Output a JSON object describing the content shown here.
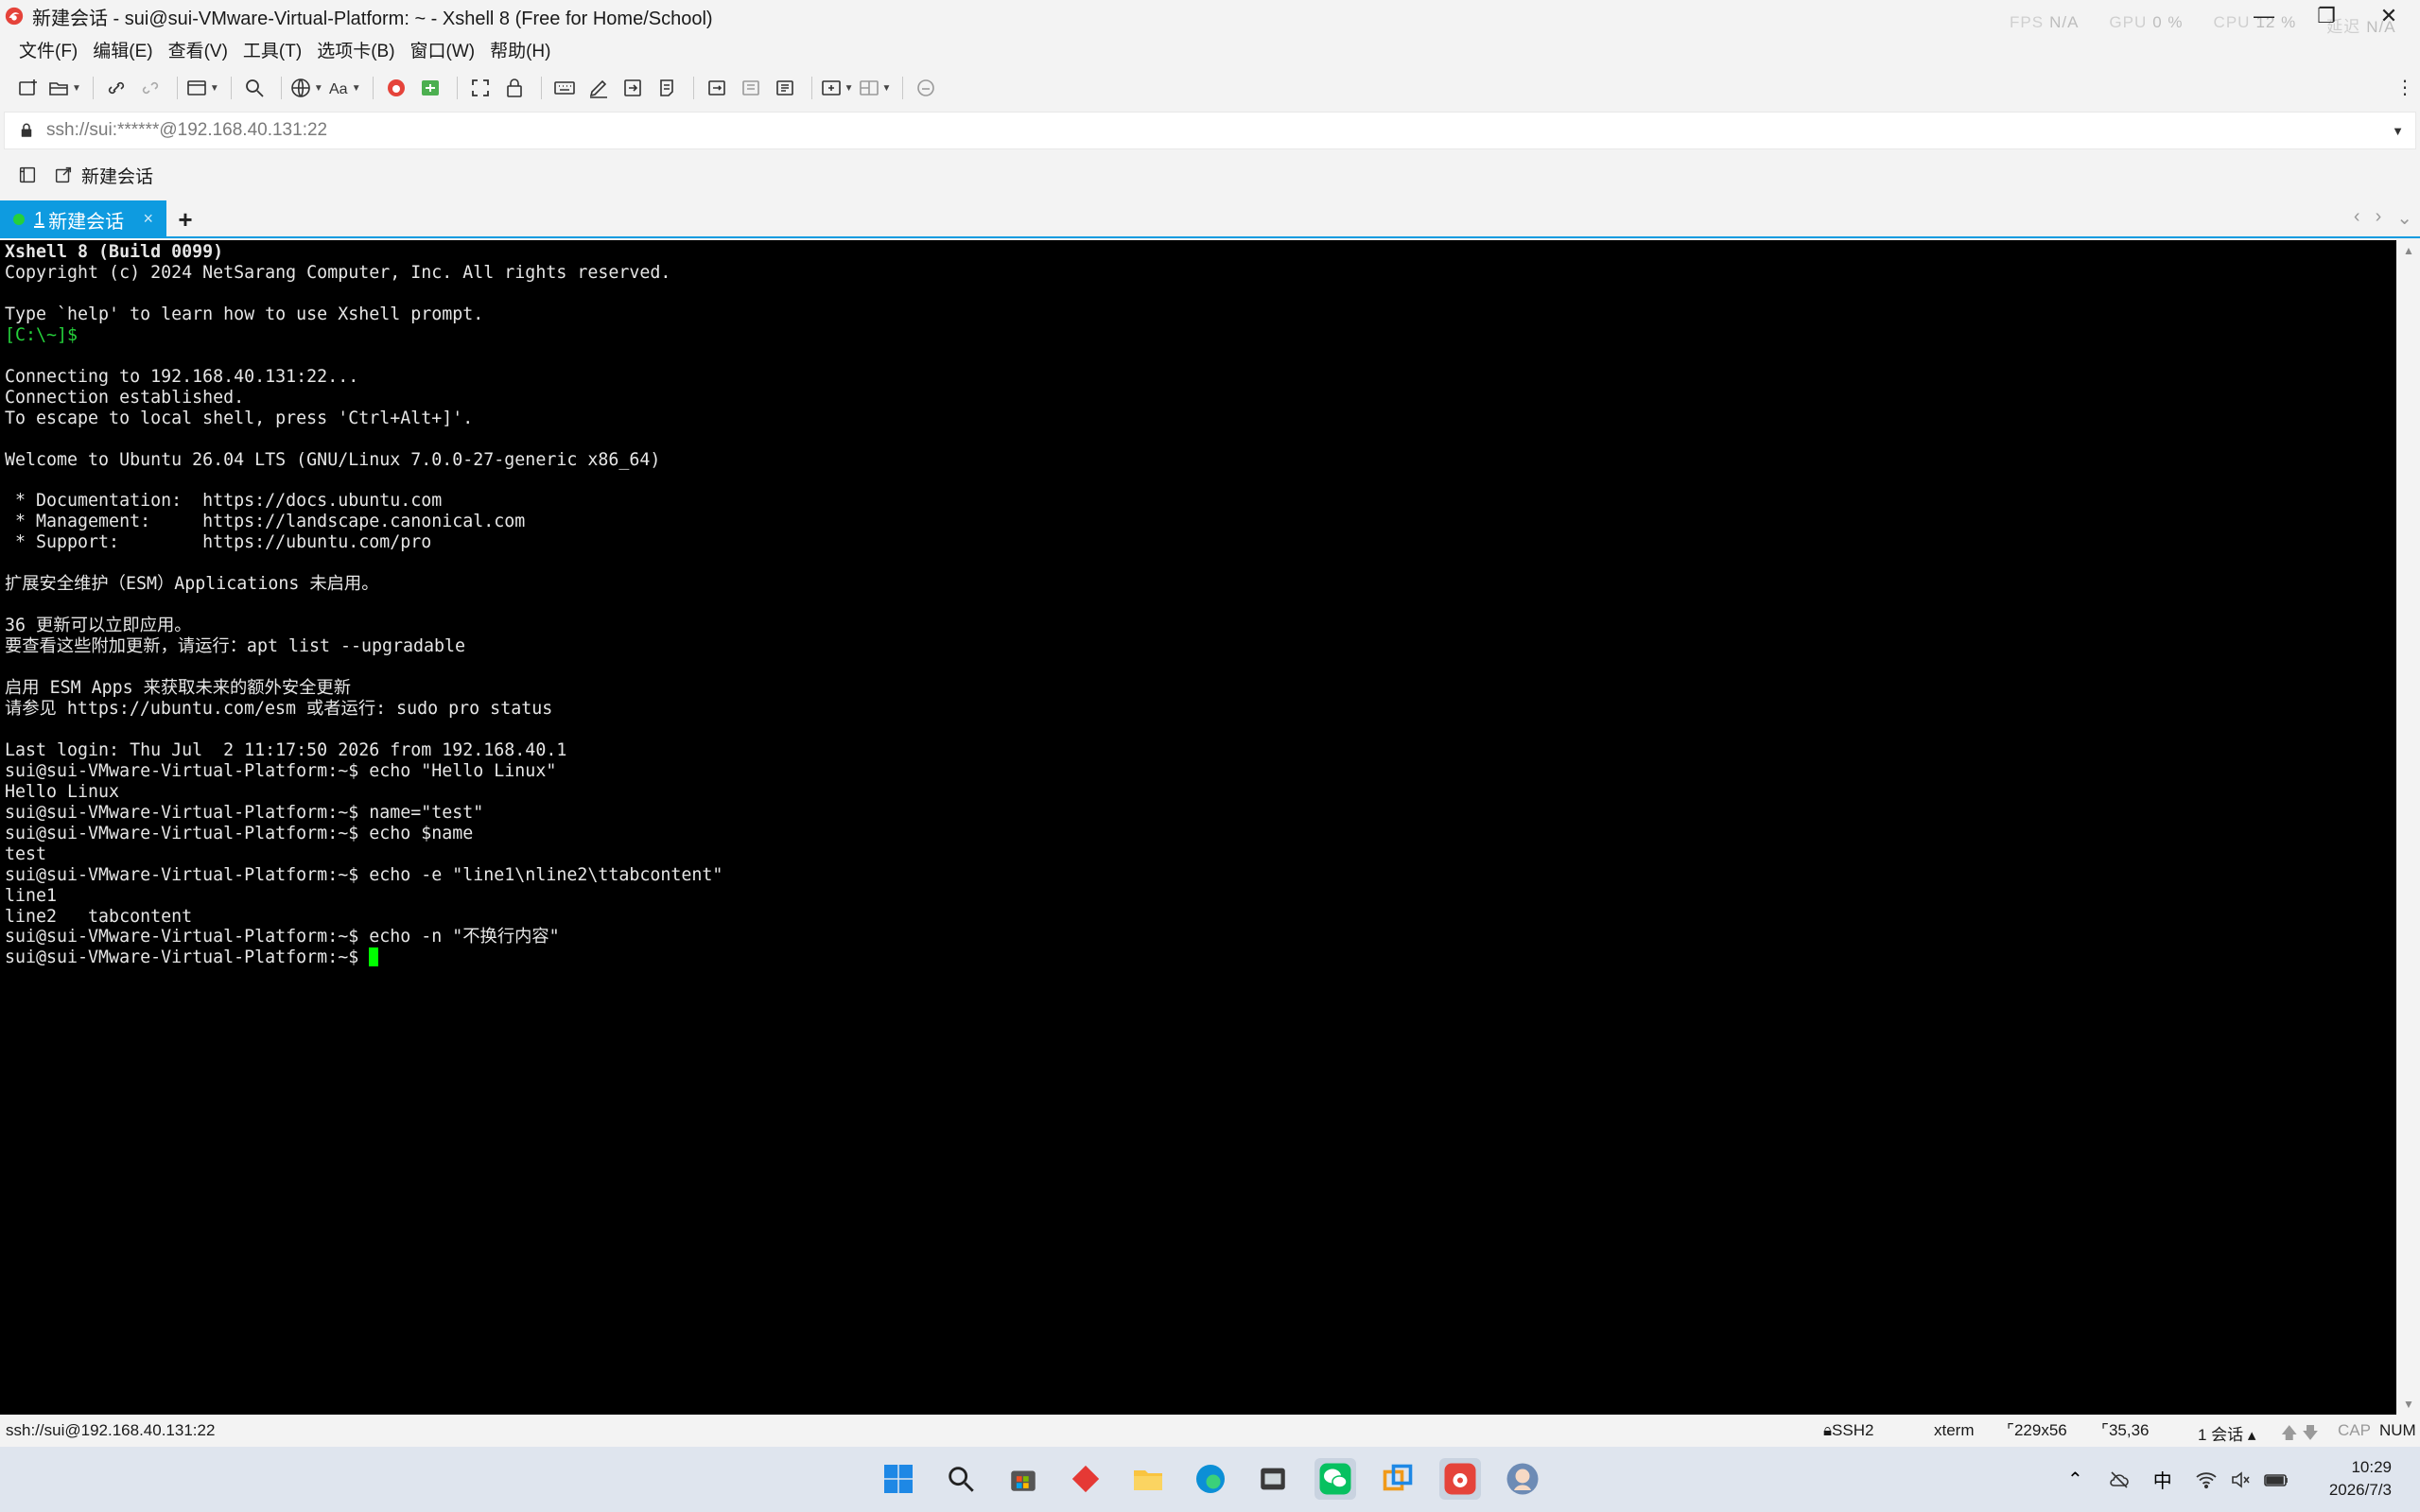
{
  "window": {
    "title": "新建会话 - sui@sui-VMware-Virtual-Platform: ~ - Xshell 8 (Free for Home/School)",
    "perf": [
      {
        "label": "FPS",
        "value": "N/A"
      },
      {
        "label": "GPU",
        "value": "0 %"
      },
      {
        "label": "CPU",
        "value": "12 %"
      },
      {
        "label": "延迟",
        "value": "N/A"
      }
    ],
    "controls": {
      "minimize": "—",
      "maximize": "❐",
      "close": "✕"
    }
  },
  "menu": [
    "文件(F)",
    "编辑(E)",
    "查看(V)",
    "工具(T)",
    "选项卡(B)",
    "窗口(W)",
    "帮助(H)"
  ],
  "address": {
    "value": "ssh://sui:******@192.168.40.131:22"
  },
  "quick": {
    "new_session": "新建会话"
  },
  "tabs": [
    {
      "number": "1",
      "label": "新建会话",
      "close": "×",
      "active": true
    }
  ],
  "tab_add": "+",
  "terminal": {
    "lines": [
      [
        {
          "t": "Xshell 8 (Build 0099)",
          "c": "bold"
        }
      ],
      [
        {
          "t": "Copyright (c) 2024 NetSarang Computer, Inc. All rights reserved."
        }
      ],
      [
        {
          "t": ""
        }
      ],
      [
        {
          "t": "Type `help' to learn how to use Xshell prompt."
        }
      ],
      [
        {
          "t": "[C:\\~]$",
          "c": "green"
        }
      ],
      [
        {
          "t": ""
        }
      ],
      [
        {
          "t": "Connecting to 192.168.40.131:22..."
        }
      ],
      [
        {
          "t": "Connection established."
        }
      ],
      [
        {
          "t": "To escape to local shell, press 'Ctrl+Alt+]'."
        }
      ],
      [
        {
          "t": ""
        }
      ],
      [
        {
          "t": "Welcome to Ubuntu 26.04 LTS (GNU/Linux 7.0.0-27-generic x86_64)"
        }
      ],
      [
        {
          "t": ""
        }
      ],
      [
        {
          "t": " * Documentation:  https://docs.ubuntu.com"
        }
      ],
      [
        {
          "t": " * Management:     https://landscape.canonical.com"
        }
      ],
      [
        {
          "t": " * Support:        https://ubuntu.com/pro"
        }
      ],
      [
        {
          "t": ""
        }
      ],
      [
        {
          "t": "扩展安全维护（ESM）Applications 未启用。"
        }
      ],
      [
        {
          "t": ""
        }
      ],
      [
        {
          "t": "36 更新可以立即应用。"
        }
      ],
      [
        {
          "t": "要查看这些附加更新，请运行：apt list --upgradable"
        }
      ],
      [
        {
          "t": ""
        }
      ],
      [
        {
          "t": "启用 ESM Apps 来获取未来的额外安全更新"
        }
      ],
      [
        {
          "t": "请参见 https://ubuntu.com/esm 或者运行: sudo pro status"
        }
      ],
      [
        {
          "t": ""
        }
      ],
      [
        {
          "t": "Last login: Thu Jul  2 11:17:50 2026 from 192.168.40.1"
        }
      ],
      [
        {
          "t": "sui@sui-VMware-Virtual-Platform:~$ echo \"Hello Linux\""
        }
      ],
      [
        {
          "t": "Hello Linux"
        }
      ],
      [
        {
          "t": "sui@sui-VMware-Virtual-Platform:~$ name=\"test\""
        }
      ],
      [
        {
          "t": "sui@sui-VMware-Virtual-Platform:~$ echo $name"
        }
      ],
      [
        {
          "t": "test"
        }
      ],
      [
        {
          "t": "sui@sui-VMware-Virtual-Platform:~$ echo -e \"line1\\nline2\\ttabcontent\""
        }
      ],
      [
        {
          "t": "line1"
        }
      ],
      [
        {
          "t": "line2   tabcontent"
        }
      ],
      [
        {
          "t": "sui@sui-VMware-Virtual-Platform:~$ echo -n \"不换行内容\""
        }
      ],
      [
        {
          "t": "sui@sui-VMware-Virtual-Platform:~$ "
        },
        {
          "cursor": true
        }
      ]
    ],
    "cursor_color": "#00ff00",
    "background": "#000000"
  },
  "status": {
    "connection": "ssh://sui@192.168.40.131:22",
    "protocol": "SSH2",
    "terminal_type": "xterm",
    "size": "229x56",
    "cursor_pos": "35,36",
    "sessions": "1 会话",
    "cap": "CAP",
    "num": "NUM"
  },
  "taskbar": {
    "ime": "中",
    "time": "10:29",
    "date": "2026/7/3"
  },
  "colors": {
    "accent": "#0e9be0",
    "tab_dot": "#25d03b",
    "prompt_green": "#25d03b"
  }
}
